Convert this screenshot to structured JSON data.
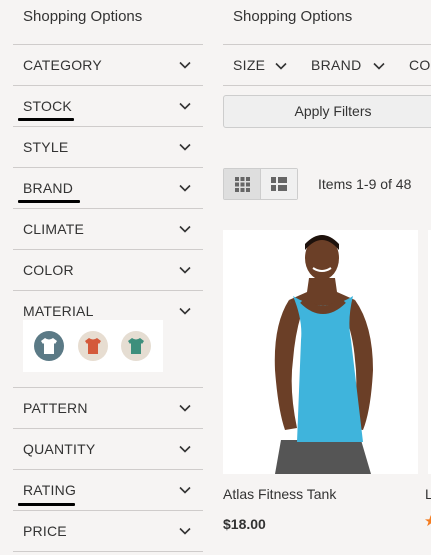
{
  "sidebar": {
    "title": "Shopping Options",
    "items": [
      {
        "label": "CATEGORY"
      },
      {
        "label": "STOCK"
      },
      {
        "label": "STYLE"
      },
      {
        "label": "BRAND"
      },
      {
        "label": "CLIMATE"
      },
      {
        "label": "COLOR"
      },
      {
        "label": "MATERIAL"
      },
      {
        "label": "PATTERN"
      },
      {
        "label": "QUANTITY"
      },
      {
        "label": "RATING"
      },
      {
        "label": "PRICE"
      }
    ],
    "material_swatches": [
      {
        "name": "white-tee",
        "color": "#ffffff"
      },
      {
        "name": "orange-tee",
        "color": "#d4593a"
      },
      {
        "name": "green-tee",
        "color": "#3d8f7c"
      }
    ]
  },
  "main": {
    "title": "Shopping Options",
    "filters": [
      {
        "label": "SIZE"
      },
      {
        "label": "BRAND"
      },
      {
        "label": "CO"
      }
    ],
    "apply_label": "Apply Filters",
    "items_count": "Items 1-9 of 48",
    "products": [
      {
        "name": "Atlas Fitness Tank",
        "price": "$18.00",
        "shirt_color": "#3fb4dc"
      },
      {
        "name": "L",
        "price": "$"
      }
    ]
  },
  "colors": {
    "background": "#f6f4f3",
    "rating_star": "#f47c20",
    "underline": "#000000"
  }
}
